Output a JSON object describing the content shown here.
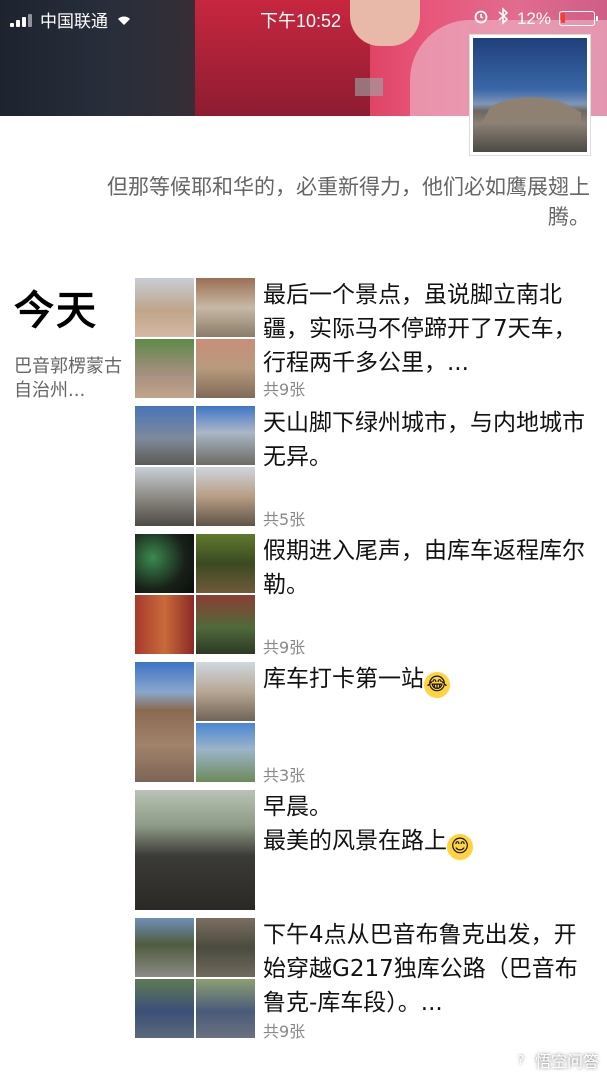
{
  "status_bar": {
    "carrier": "中国联通",
    "time": "下午10:52",
    "battery": "12%",
    "battery_level": 0.12,
    "signal_icon": "signal-icon",
    "wifi_icon": "wifi-icon",
    "alarm_icon": "alarm-icon",
    "bluetooth_icon": "bluetooth-icon"
  },
  "profile": {
    "signature": "但那等候耶和华的，必重新得力，他们必如鹰展翅上腾。"
  },
  "timeline": {
    "day_label": "今天",
    "location": "巴音郭楞蒙古自治州..."
  },
  "posts": [
    {
      "text": "最后一个景点，虽说脚立南北疆，实际马不停蹄开了7天车，行程两千多公里，...",
      "count": "共9张"
    },
    {
      "text": "天山脚下绿州城市，与内地城市无异。",
      "count": "共5张"
    },
    {
      "text": "假期进入尾声，由库车返程库尔勒。",
      "count": "共9张"
    },
    {
      "text": "库车打卡第一站",
      "count": "共3张",
      "emoji": "😂"
    },
    {
      "text_line1": "早晨。",
      "text_line2": "最美的风景在路上",
      "count": "",
      "emoji": "😊"
    },
    {
      "text": "下午4点从巴音布鲁克出发，开始穿越G217独库公路（巴音布鲁克-库车段）。...",
      "count": "共9张"
    }
  ],
  "watermark": {
    "text": "悟空问答"
  }
}
